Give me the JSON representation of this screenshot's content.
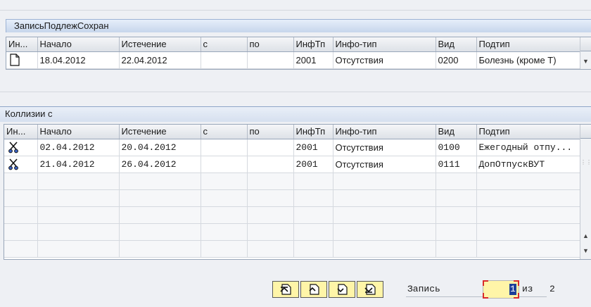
{
  "record_group": {
    "title": "ЗаписьПодлежСохран",
    "columns": [
      "Ин...",
      "Начало",
      "Истечение",
      "с",
      "по",
      "ИнфТп",
      "Инфо-тип",
      "Вид",
      "Подтип"
    ],
    "rows": [
      {
        "icon": "document-icon",
        "start": "18.04.2012",
        "end": "22.04.2012",
        "from": "",
        "to": "",
        "inftp": "2001",
        "infotype": "Отсутствия",
        "vid": "0200",
        "subtype": "Болезнь (кроме Т)"
      }
    ]
  },
  "collisions": {
    "title": "Коллизии с",
    "columns": [
      "Ин...",
      "Начало",
      "Истечение",
      "с",
      "по",
      "ИнфТп",
      "Инфо-тип",
      "Вид",
      "Подтип"
    ],
    "rows": [
      {
        "icon": "scissors-icon",
        "start": "02.04.2012",
        "end": "20.04.2012",
        "from": "",
        "to": "",
        "inftp": "2001",
        "infotype": "Отсутствия",
        "vid": "0100",
        "subtype": "Ежегодный отпу..."
      },
      {
        "icon": "scissors-icon",
        "start": "21.04.2012",
        "end": "26.04.2012",
        "from": "",
        "to": "",
        "inftp": "2001",
        "infotype": "Отсутствия",
        "vid": "0111",
        "subtype": "ДопОтпускВУТ"
      }
    ]
  },
  "footer": {
    "record_label": "Запись",
    "record_value": "1",
    "of_label": "из",
    "total": "2",
    "buttons": [
      "first-page-icon",
      "previous-page-icon",
      "next-page-icon",
      "last-page-icon"
    ]
  },
  "colors": {
    "input_yellow": "#fff5a8",
    "selection_blue": "#1d3f99",
    "focus_red": "#d92b2b"
  }
}
